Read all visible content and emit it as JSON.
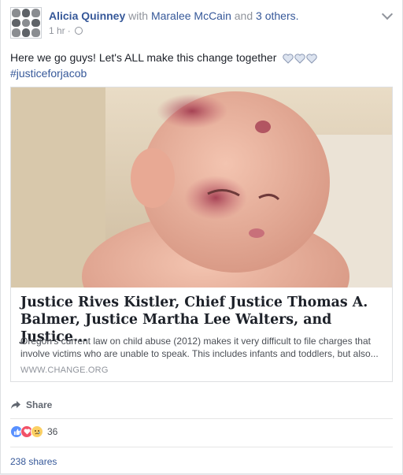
{
  "post": {
    "author": "Alicia Quinney",
    "with_word": "with",
    "tagged": "Maralee McCain",
    "and_word": "and",
    "others": "3 others.",
    "time": "1 hr",
    "separator": "·",
    "text": "Here we go guys! Let's ALL make this change together",
    "hashtag": "#justiceforjacob"
  },
  "attachment": {
    "title": "Justice Rives Kistler, Chief Justice Thomas A. Balmer, Justice Martha Lee Walters, and Justice...",
    "description": "Oregon's current law on child abuse (2012) makes it very difficult to file charges that involve victims who are unable to speak. This includes infants and toddlers, but also...",
    "domain": "WWW.CHANGE.ORG"
  },
  "actions": {
    "share_label": "Share"
  },
  "reactions": {
    "icons": [
      "like-icon",
      "love-icon",
      "sad-icon"
    ],
    "count": "36"
  },
  "shares": {
    "label": "238 shares"
  },
  "colors": {
    "link": "#365899",
    "like": "#5890ff",
    "love": "#f25268",
    "sad": "#fcd064"
  }
}
